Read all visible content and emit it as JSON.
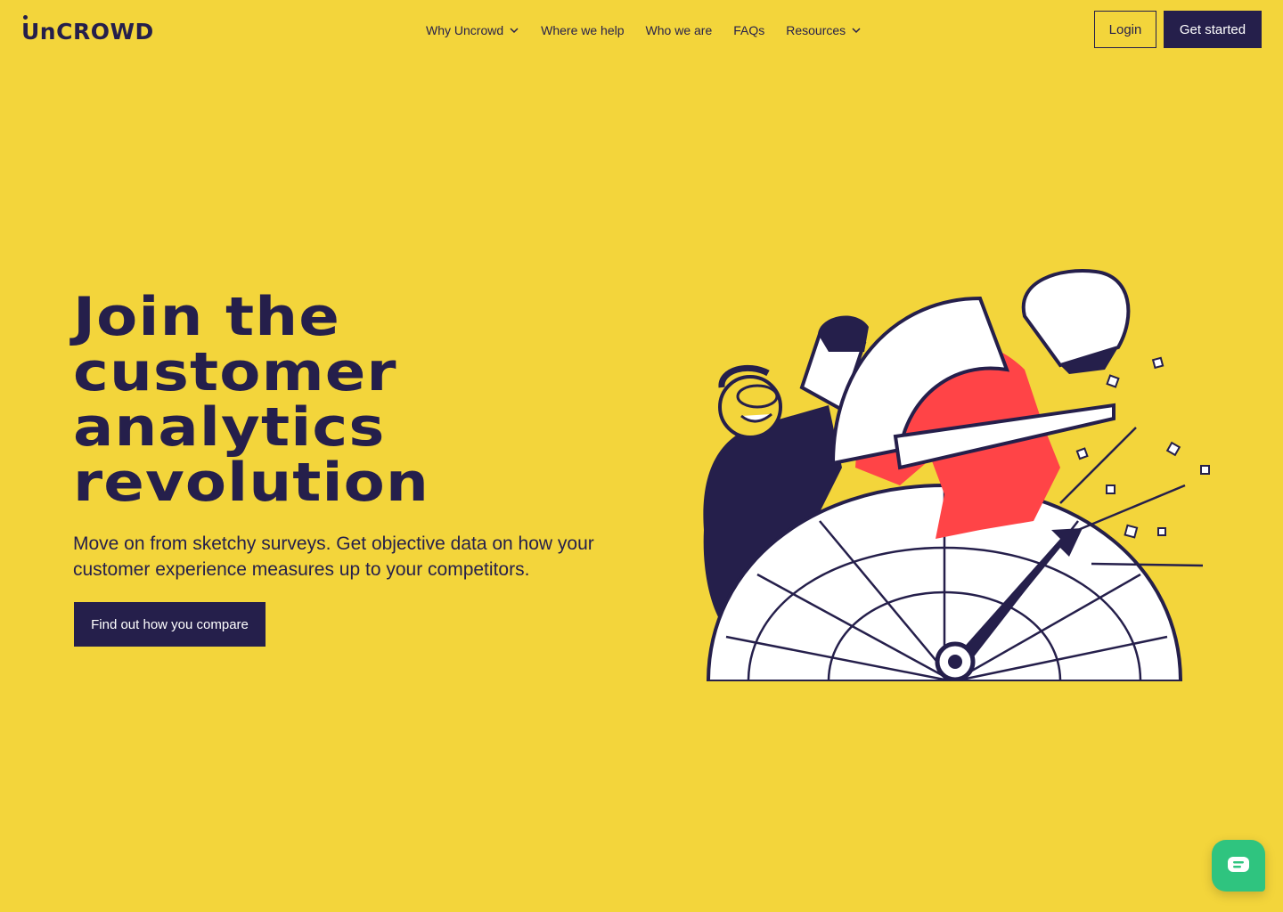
{
  "brand": {
    "name": "UnCROWD"
  },
  "nav": {
    "items": [
      {
        "label": "Why Uncrowd",
        "has_dropdown": true
      },
      {
        "label": "Where we help",
        "has_dropdown": false
      },
      {
        "label": "Who we are",
        "has_dropdown": false
      },
      {
        "label": "FAQs",
        "has_dropdown": false
      },
      {
        "label": "Resources",
        "has_dropdown": true
      }
    ],
    "login_label": "Login",
    "get_started_label": "Get started"
  },
  "hero": {
    "title_lines": [
      "Join the",
      "customer",
      "analytics",
      "revolution"
    ],
    "subtitle": "Move on from sketchy surveys. Get objective data on how your customer experience measures up to your competitors.",
    "cta_label": "Find out how you compare"
  },
  "colors": {
    "background": "#f3d53b",
    "ink": "#251f4b",
    "accent_red": "#ff4447",
    "chat_green": "#2fc47f"
  },
  "chat": {
    "icon": "chat-bubble-icon"
  }
}
